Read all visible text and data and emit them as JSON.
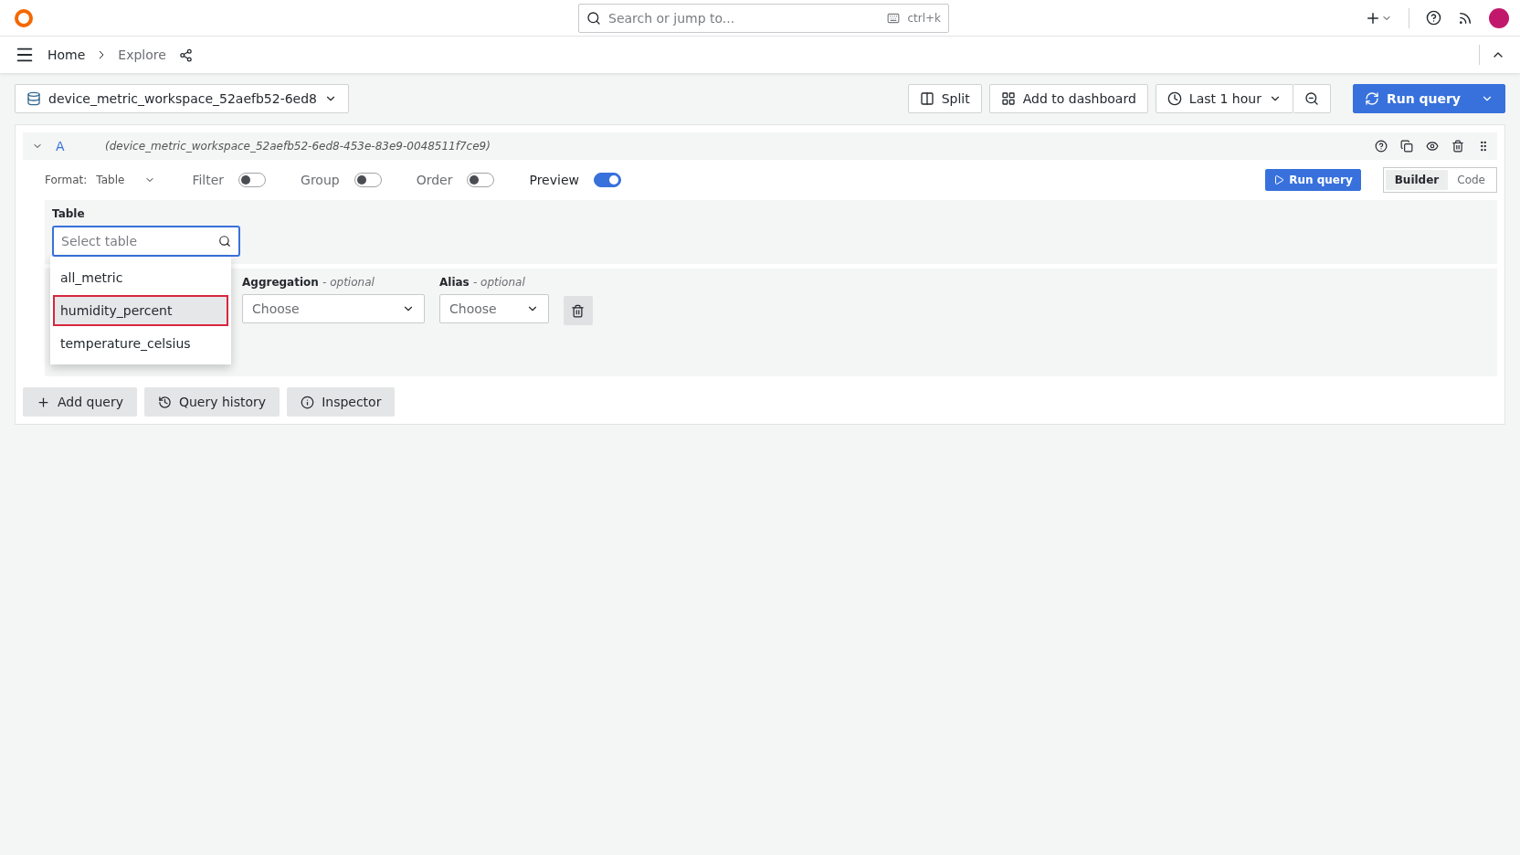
{
  "topbar": {
    "search_placeholder": "Search or jump to...",
    "shortcut": "ctrl+k"
  },
  "breadcrumbs": [
    {
      "label": "Home",
      "current": false
    },
    {
      "label": "Explore",
      "current": true
    }
  ],
  "toolbar": {
    "datasource": "device_metric_workspace_52aefb52-6ed8",
    "split": "Split",
    "add_to_dashboard": "Add to dashboard",
    "time_range": "Last 1 hour",
    "run_query": "Run query"
  },
  "query": {
    "ref": "A",
    "datasource_uid": "(device_metric_workspace_52aefb52-6ed8-453e-83e9-0048511f7ce9)",
    "format_label": "Format:",
    "format_value": "Table",
    "toggles": [
      {
        "label": "Filter",
        "on": false
      },
      {
        "label": "Group",
        "on": false
      },
      {
        "label": "Order",
        "on": false
      },
      {
        "label": "Preview",
        "on": true
      }
    ],
    "run_query": "Run query",
    "modes": [
      {
        "label": "Builder",
        "selected": true
      },
      {
        "label": "Code",
        "selected": false
      }
    ],
    "table_label": "Table",
    "table_placeholder": "Select table",
    "table_options": [
      {
        "label": "all_metric",
        "selected": false
      },
      {
        "label": "humidity_percent",
        "selected": true
      },
      {
        "label": "temperature_celsius",
        "selected": false
      }
    ],
    "aggregation_label": "Aggregation",
    "aggregation_hint": "- optional",
    "aggregation_value": "Choose",
    "alias_label": "Alias",
    "alias_hint": "- optional",
    "alias_value": "Choose"
  },
  "actions": [
    "Add query",
    "Query history",
    "Inspector"
  ]
}
